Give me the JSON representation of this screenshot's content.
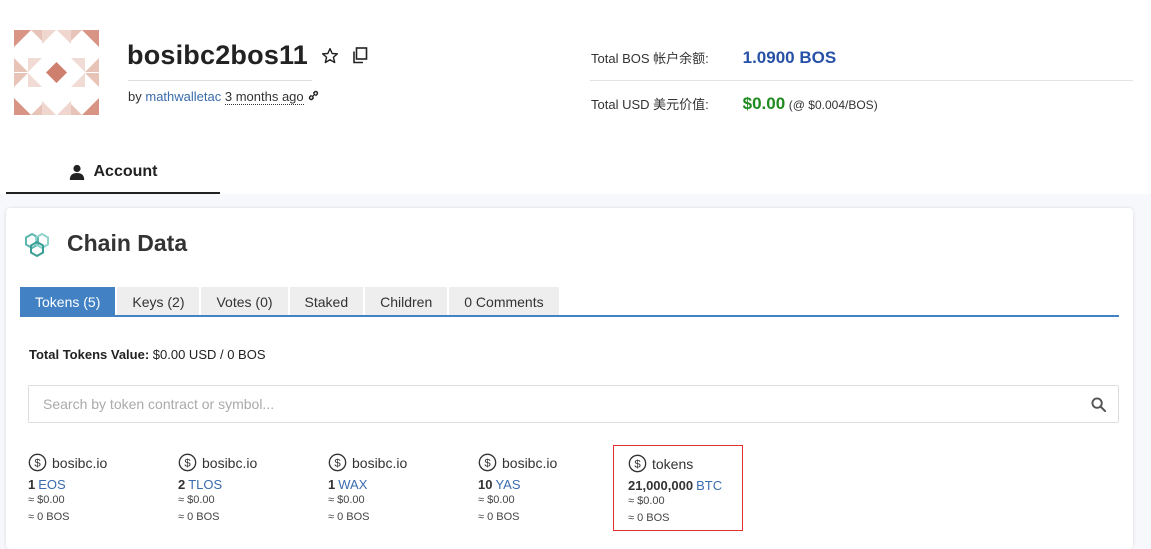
{
  "account": {
    "name": "bosibc2bos11",
    "by_label": "by",
    "creator": "mathwalletac",
    "created_ago": "3 months ago"
  },
  "balances": {
    "bos_label": "Total BOS 帐户余额:",
    "bos_value": "1.0900 BOS",
    "usd_label": "Total USD 美元价值:",
    "usd_value": "$0.00",
    "usd_rate": "(@ $0.004/BOS)"
  },
  "nav": {
    "account_tab": "Account"
  },
  "chain": {
    "title": "Chain Data",
    "tabs": [
      {
        "label": "Tokens (5)",
        "active": true
      },
      {
        "label": "Keys (2)",
        "active": false
      },
      {
        "label": "Votes (0)",
        "active": false
      },
      {
        "label": "Staked",
        "active": false
      },
      {
        "label": "Children",
        "active": false
      },
      {
        "label": "0 Comments",
        "active": false
      }
    ],
    "total_label": "Total Tokens Value:",
    "total_value": "$0.00 USD / 0 BOS",
    "search_placeholder": "Search by token contract or symbol..."
  },
  "tokens": [
    {
      "contract": "bosibc.io",
      "amount": "1",
      "symbol": "EOS",
      "usd": "≈ $0.00",
      "bos": "≈ 0 BOS"
    },
    {
      "contract": "bosibc.io",
      "amount": "2",
      "symbol": "TLOS",
      "usd": "≈ $0.00",
      "bos": "≈ 0 BOS"
    },
    {
      "contract": "bosibc.io",
      "amount": "1",
      "symbol": "WAX",
      "usd": "≈ $0.00",
      "bos": "≈ 0 BOS"
    },
    {
      "contract": "bosibc.io",
      "amount": "10",
      "symbol": "YAS",
      "usd": "≈ $0.00",
      "bos": "≈ 0 BOS"
    },
    {
      "contract": "tokens",
      "amount": "21,000,000",
      "symbol": "BTC",
      "usd": "≈ $0.00",
      "bos": "≈ 0 BOS",
      "highlighted": true
    }
  ],
  "colors": {
    "accent": "#4282c4",
    "bos_value": "#2651a6",
    "usd_value": "#1f8a1f",
    "link": "#3a6cae",
    "highlight_border": "#dd3333",
    "avatar": "#d9a08f"
  }
}
